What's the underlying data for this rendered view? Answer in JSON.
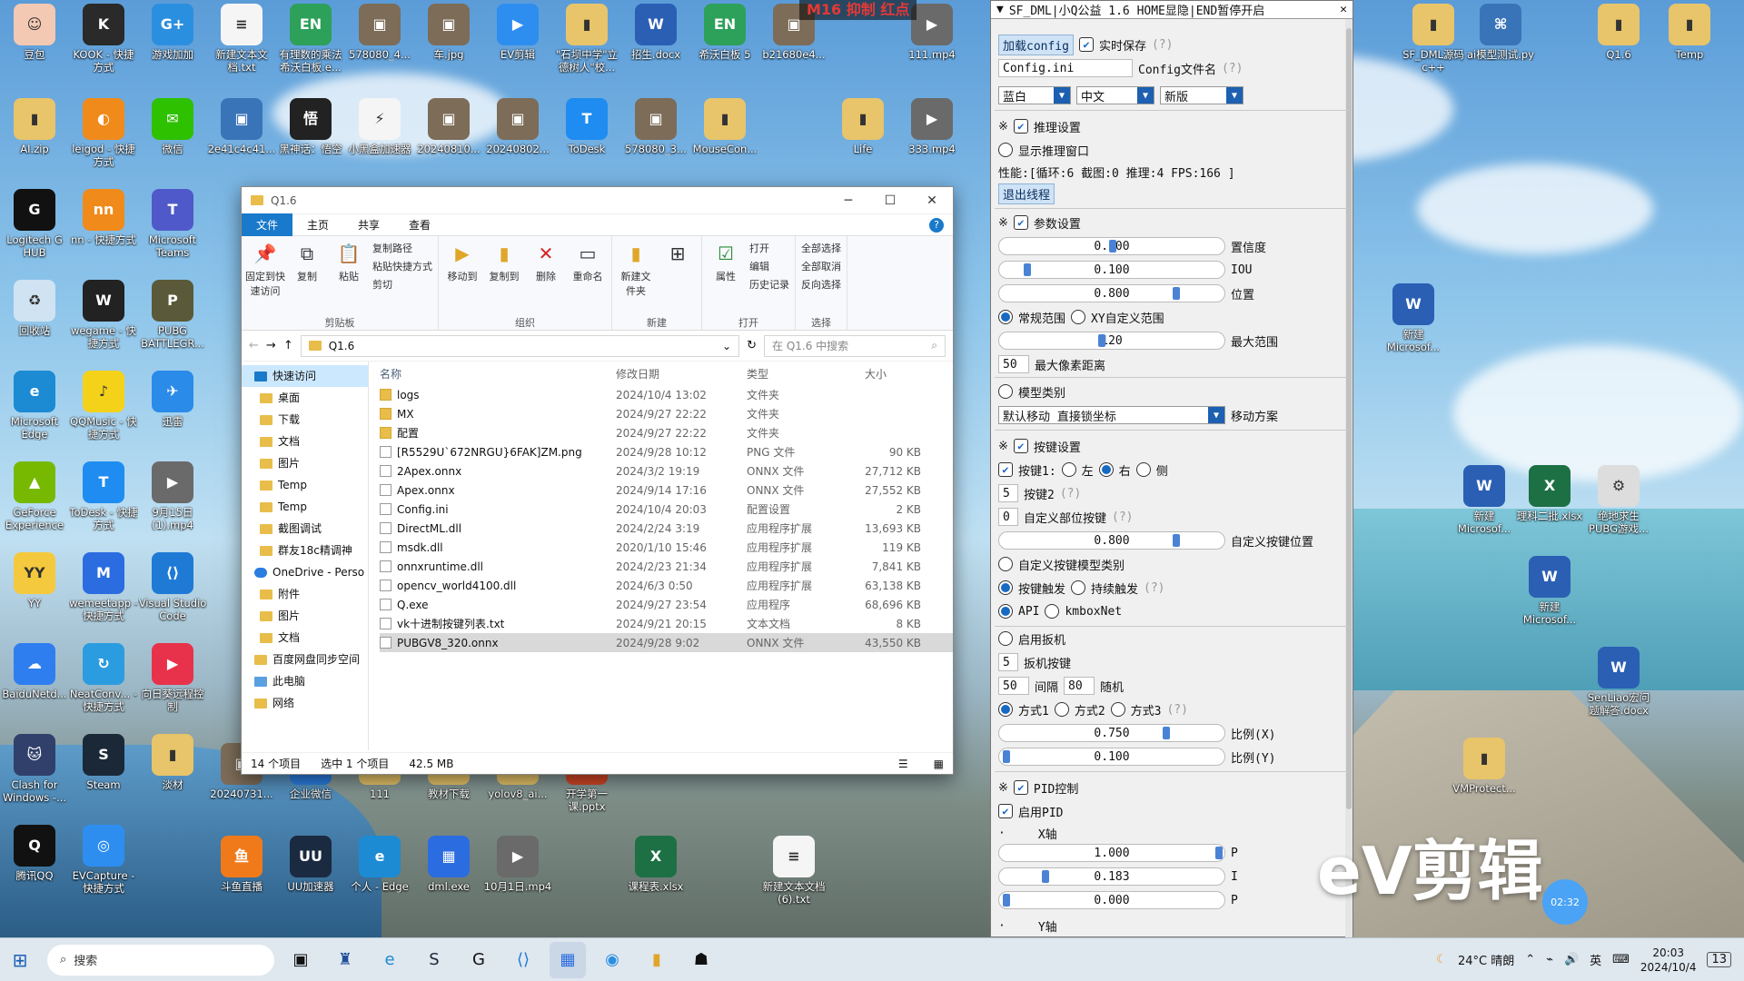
{
  "desktop_icons_left": [
    {
      "label": "豆包",
      "color": "#f3c9b3",
      "glyph": "☺"
    },
    {
      "label": "KOOK - 快捷方式",
      "color": "#2a2a2a",
      "glyph": "K"
    },
    {
      "label": "游戏加加",
      "color": "#2b8fe0",
      "glyph": "G+"
    },
    {
      "label": "新建文本文档.txt",
      "color": "#f5f5f5",
      "glyph": "≡"
    },
    {
      "label": "有理数的乘法 希沃白板.e...",
      "color": "#2da05a",
      "glyph": "EN"
    },
    {
      "label": "578080_4...",
      "color": "#7c6c58",
      "glyph": "▣"
    },
    {
      "label": "车.jpg",
      "color": "#7c6c58",
      "glyph": "▣"
    },
    {
      "label": "EV剪辑",
      "color": "#2e8ef0",
      "glyph": "▶"
    },
    {
      "label": "\"石坝中学\"立德树人\"校...",
      "color": "#e8c46a",
      "glyph": "▮"
    },
    {
      "label": "招生.docx",
      "color": "#2b5fb4",
      "glyph": "W"
    },
    {
      "label": "希沃白板 5",
      "color": "#2da05a",
      "glyph": "EN"
    },
    {
      "label": "b21680e4...",
      "color": "#7c6c58",
      "glyph": "▣"
    },
    {
      "label": "111.mp4",
      "color": "#6a6a6a",
      "glyph": "▶"
    }
  ],
  "desktop_row2": [
    {
      "label": "AI.zip",
      "color": "#e8c46a",
      "glyph": "▮"
    },
    {
      "label": "leigod - 快捷方式",
      "color": "#f08a1a",
      "glyph": "◐"
    },
    {
      "label": "微信",
      "color": "#2dc100",
      "glyph": "✉"
    },
    {
      "label": "2e41c4c41...",
      "color": "#3a74b8",
      "glyph": "▣"
    },
    {
      "label": "黑神话：悟空",
      "color": "#222",
      "glyph": "悟"
    },
    {
      "label": "小黑盒加速器",
      "color": "#f5f5f5",
      "glyph": "⚡"
    },
    {
      "label": "20240810...",
      "color": "#7c6c58",
      "glyph": "▣"
    },
    {
      "label": "20240802...",
      "color": "#7c6c58",
      "glyph": "▣"
    },
    {
      "label": "ToDesk",
      "color": "#1e8cf0",
      "glyph": "T"
    },
    {
      "label": "578080_3...",
      "color": "#7c6c58",
      "glyph": "▣"
    },
    {
      "label": "MouseCon...",
      "color": "#e8c46a",
      "glyph": "▮"
    },
    {
      "label": "Life",
      "color": "#e8c46a",
      "glyph": "▮"
    },
    {
      "label": "333.mp4",
      "color": "#6a6a6a",
      "glyph": "▶"
    }
  ],
  "desktop_col_left": [
    {
      "label": "Logitech G HUB",
      "color": "#111",
      "glyph": "G"
    },
    {
      "label": "回收站",
      "color": "#cfe3f2",
      "glyph": "♻"
    },
    {
      "label": "Microsoft Edge",
      "color": "#1c8bd4",
      "glyph": "e"
    },
    {
      "label": "GeForce Experience",
      "color": "#76b900",
      "glyph": "▲"
    },
    {
      "label": "YY",
      "color": "#f5c93d",
      "glyph": "YY"
    },
    {
      "label": "BaiduNetd...",
      "color": "#2f7ef0",
      "glyph": "☁"
    },
    {
      "label": "Clash for Windows -...",
      "color": "#30406a",
      "glyph": "🐱"
    },
    {
      "label": "腾讯QQ",
      "color": "#111",
      "glyph": "Q"
    }
  ],
  "desktop_col2": [
    {
      "label": "nn - 快捷方式",
      "color": "#f08a1a",
      "glyph": "nn"
    },
    {
      "label": "wegame - 快捷方式",
      "color": "#222",
      "glyph": "W"
    },
    {
      "label": "QQMusic - 快捷方式",
      "color": "#f5d21a",
      "glyph": "♪"
    },
    {
      "label": "ToDesk - 快捷方式",
      "color": "#1e8cf0",
      "glyph": "T"
    },
    {
      "label": "wemeetapp - 快捷方式",
      "color": "#2b6ce0",
      "glyph": "M"
    },
    {
      "label": "NeatConv... - 快捷方式",
      "color": "#2b9ce0",
      "glyph": "↻"
    },
    {
      "label": "Steam",
      "color": "#1b2838",
      "glyph": "S"
    },
    {
      "label": "EVCapture - 快捷方式",
      "color": "#2e8ef0",
      "glyph": "◎"
    }
  ],
  "desktop_col3": [
    {
      "label": "Microsoft Teams",
      "color": "#5059c9",
      "glyph": "T"
    },
    {
      "label": "PUBG BATTLEGR...",
      "color": "#5a5a3a",
      "glyph": "P"
    },
    {
      "label": "迅雷",
      "color": "#2a8be8",
      "glyph": "✈"
    },
    {
      "label": "9月15日(1).mp4",
      "color": "#6a6a6a",
      "glyph": "▶"
    },
    {
      "label": "Visual Studio Code",
      "color": "#1f7ad6",
      "glyph": "⟨⟩"
    },
    {
      "label": "向日葵远程控制",
      "color": "#e8324b",
      "glyph": "▶"
    },
    {
      "label": "淡材",
      "color": "#e8c46a",
      "glyph": "▮"
    }
  ],
  "desktop_bottom": [
    {
      "label": "20240731...",
      "color": "#7c6c58",
      "glyph": "▣"
    },
    {
      "label": "企业微信",
      "color": "#2b7de0",
      "glyph": "✉"
    },
    {
      "label": "111",
      "color": "#e8c46a",
      "glyph": "▮"
    },
    {
      "label": "教材下载",
      "color": "#e8c46a",
      "glyph": "▮"
    },
    {
      "label": "yolov8_ai...",
      "color": "#e8c46a",
      "glyph": "▮"
    },
    {
      "label": "开学第一课.pptx",
      "color": "#d24726",
      "glyph": "P"
    },
    {
      "label": "斗鱼直播",
      "color": "#f07a1a",
      "glyph": "鱼"
    },
    {
      "label": "UU加速器",
      "color": "#1a2a40",
      "glyph": "UU"
    },
    {
      "label": "个人 - Edge",
      "color": "#1c8bd4",
      "glyph": "e"
    },
    {
      "label": "dml.exe",
      "color": "#2b6ce0",
      "glyph": "▦"
    },
    {
      "label": "10月1日.mp4",
      "color": "#6a6a6a",
      "glyph": "▶"
    },
    {
      "label": "课程表.xlsx",
      "color": "#1d7044",
      "glyph": "X"
    },
    {
      "label": "新建文本文档(6).txt",
      "color": "#f5f5f5",
      "glyph": "≡"
    }
  ],
  "desktop_right": [
    {
      "label": "Q1.6",
      "color": "#e8c46a",
      "glyph": "▮"
    },
    {
      "label": "Temp",
      "color": "#e8c46a",
      "glyph": "▮"
    },
    {
      "label": "新建Microsof...",
      "color": "#2b5fb4",
      "glyph": "W"
    },
    {
      "label": "新建Microsof...",
      "color": "#2b5fb4",
      "glyph": "W"
    },
    {
      "label": "理科二批.xlsx",
      "color": "#1d7044",
      "glyph": "X"
    },
    {
      "label": "绝地求生PUBG游戏...",
      "color": "#ddd",
      "glyph": "⚙"
    },
    {
      "label": "新建Microsof...",
      "color": "#2b5fb4",
      "glyph": "W"
    },
    {
      "label": "SenLiao宏问题解答.docx",
      "color": "#2b5fb4",
      "glyph": "W"
    },
    {
      "label": "VMProtect...",
      "color": "#e8c46a",
      "glyph": "▮"
    },
    {
      "label": "SF_DML源码c++",
      "color": "#e8c46a",
      "glyph": "▮"
    },
    {
      "label": "ai模型测试.py",
      "color": "#3a74b8",
      "glyph": "⌘"
    }
  ],
  "watermark_top": "M16 抑制 红点",
  "explorer": {
    "title": "Q1.6",
    "tabs": [
      "文件",
      "主页",
      "共享",
      "查看"
    ],
    "ribbon": {
      "pin": "固定到快速访问",
      "copy": "复制",
      "paste": "粘贴",
      "copy_path": "复制路径",
      "paste_shortcut": "粘贴快捷方式",
      "cut": "剪切",
      "clipboard": "剪贴板",
      "move_to": "移动到",
      "copy_to": "复制到",
      "delete": "删除",
      "rename": "重命名",
      "organize": "组织",
      "new_folder": "新建文件夹",
      "new": "新建",
      "properties": "属性",
      "open": "打开",
      "edit": "编辑",
      "history": "历史记录",
      "open_group": "打开",
      "select_all": "全部选择",
      "select_none": "全部取消",
      "invert": "反向选择",
      "select_group": "选择"
    },
    "path": "Q1.6",
    "search_placeholder": "在 Q1.6 中搜索",
    "nav": [
      {
        "label": "快速访问",
        "sel": true
      },
      {
        "label": "桌面"
      },
      {
        "label": "下载"
      },
      {
        "label": "文档"
      },
      {
        "label": "图片"
      },
      {
        "label": "Temp"
      },
      {
        "label": "Temp"
      },
      {
        "label": "截图调试"
      },
      {
        "label": "群友18c精调神"
      },
      {
        "label": "OneDrive - Perso"
      },
      {
        "label": "附件"
      },
      {
        "label": "图片"
      },
      {
        "label": "文档"
      },
      {
        "label": "百度网盘同步空间"
      },
      {
        "label": "此电脑"
      },
      {
        "label": "网络"
      }
    ],
    "columns": [
      "名称",
      "修改日期",
      "类型",
      "大小"
    ],
    "files": [
      {
        "name": "logs",
        "date": "2024/10/4 13:02",
        "type": "文件夹",
        "size": "",
        "dir": true
      },
      {
        "name": "MX",
        "date": "2024/9/27 22:22",
        "type": "文件夹",
        "size": "",
        "dir": true
      },
      {
        "name": "配置",
        "date": "2024/9/27 22:22",
        "type": "文件夹",
        "size": "",
        "dir": true
      },
      {
        "name": "[R5529U`672NRGU}6FAK]ZM.png",
        "date": "2024/9/28 10:12",
        "type": "PNG 文件",
        "size": "90 KB"
      },
      {
        "name": "2Apex.onnx",
        "date": "2024/3/2 19:19",
        "type": "ONNX 文件",
        "size": "27,712 KB"
      },
      {
        "name": "Apex.onnx",
        "date": "2024/9/14 17:16",
        "type": "ONNX 文件",
        "size": "27,552 KB"
      },
      {
        "name": "Config.ini",
        "date": "2024/10/4 20:03",
        "type": "配置设置",
        "size": "2 KB"
      },
      {
        "name": "DirectML.dll",
        "date": "2024/2/24 3:19",
        "type": "应用程序扩展",
        "size": "13,693 KB"
      },
      {
        "name": "msdk.dll",
        "date": "2020/1/10 15:46",
        "type": "应用程序扩展",
        "size": "119 KB"
      },
      {
        "name": "onnxruntime.dll",
        "date": "2024/2/23 21:34",
        "type": "应用程序扩展",
        "size": "7,841 KB"
      },
      {
        "name": "opencv_world4100.dll",
        "date": "2024/6/3 0:50",
        "type": "应用程序扩展",
        "size": "63,138 KB"
      },
      {
        "name": "Q.exe",
        "date": "2024/9/27 23:54",
        "type": "应用程序",
        "size": "68,696 KB"
      },
      {
        "name": "vk十进制按键列表.txt",
        "date": "2024/9/21 20:15",
        "type": "文本文档",
        "size": "8 KB"
      },
      {
        "name": "PUBGV8_320.onnx",
        "date": "2024/9/28 9:02",
        "type": "ONNX 文件",
        "size": "43,550 KB",
        "sel": true
      }
    ],
    "status_count": "14 个项目",
    "status_selected": "选中 1 个项目",
    "status_size": "42.5 MB"
  },
  "panel": {
    "title": "SF_DML|小Q公益 1.6 HOME显隐|END暂停开启",
    "load_config": "加载config",
    "realtime_save": "实时保存",
    "q": "(?)",
    "config_value": "Config.ini",
    "config_label": "Config文件名",
    "theme": "蓝白",
    "lang": "中文",
    "version": "新版",
    "sec_mark": "※",
    "infer_settings": "推理设置",
    "show_infer_window": "显示推理窗口",
    "perf": "性能:[循环:6   截图:0   推理:4   FPS:166 ]",
    "exit_thread": "退出线程",
    "param_settings": "参数设置",
    "conf_val": "0.500",
    "conf_label": "置信度",
    "conf_level": 0.5,
    "iou_val": "0.100",
    "iou_label": "IOU",
    "iou_level": 0.1,
    "pos_val": "0.800",
    "pos_label": "位置",
    "pos_level": 0.8,
    "normal_range": "常规范围",
    "xy_range": "XY自定义范围",
    "max_range_val": "120",
    "max_range_label": "最大范围",
    "max_range_level": 0.45,
    "max_px_val": "50",
    "max_px_label": "最大像素距离",
    "model_class": "模型类别",
    "move_mode": "默认移动 直接锁坐标",
    "move_label": "移动方案",
    "key_settings": "按键设置",
    "key1": "按键1:",
    "left": "左",
    "right": "右",
    "side": "侧",
    "key2_val": "5",
    "key2": "按键2",
    "custom_key_val": "0",
    "custom_key": "自定义部位按键",
    "custom_pos_val": "0.800",
    "custom_pos_label": "自定义按键位置",
    "custom_pos_level": 0.8,
    "custom_key_class": "自定义按键模型类别",
    "key_trigger": "按键触发",
    "hold_trigger": "持续触发",
    "api": "API",
    "kmbox": "kmboxNet",
    "enable_trigger": "启用扳机",
    "trigger_key_val": "5",
    "trigger_key": "扳机按键",
    "interval_val": "50",
    "interval": "间隔",
    "random_val": "80",
    "random": "随机",
    "mode1": "方式1",
    "mode2": "方式2",
    "mode3": "方式3",
    "ratio_x_val": "0.750",
    "ratio_x": "比例(X)",
    "ratio_x_level": 0.75,
    "ratio_y_val": "0.100",
    "ratio_y": "比例(Y)",
    "ratio_y_level": 0.0,
    "pid_control": "PID控制",
    "enable_pid": "启用PID",
    "x_axis": "X轴",
    "p_val": "1.000",
    "p": "P",
    "p_level": 1.0,
    "i_val": "0.183",
    "i": "I",
    "i_level": 0.183,
    "d_val": "0.000",
    "d": "P",
    "d_level": 0.0,
    "y_axis": "Y轴"
  },
  "taskbar": {
    "search": "搜索",
    "weather": "24°C 晴朗",
    "ime": "英",
    "time": "20:03",
    "date": "2024/10/4",
    "notif": "13"
  },
  "ev_brand": "eV剪辑",
  "ev_time": "02:32"
}
